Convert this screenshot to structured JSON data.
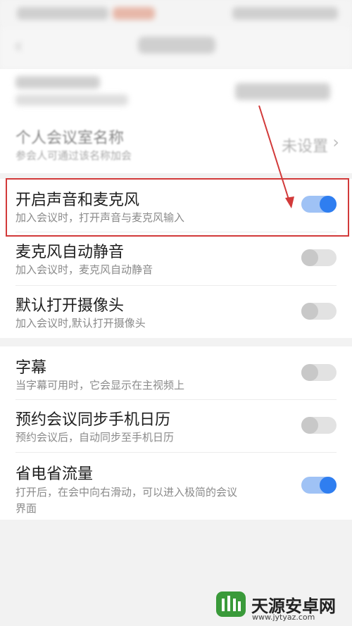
{
  "app": {
    "title": "会议设置"
  },
  "room_name": {
    "title": "个人会议室名称",
    "subtitle": "参会人可通过该名称加会",
    "value": "未设置"
  },
  "settings_group1": [
    {
      "title": "开启声音和麦克风",
      "subtitle": "加入会议时，打开声音与麦克风输入",
      "on": true
    },
    {
      "title": "麦克风自动静音",
      "subtitle": "加入会议时，麦克风自动静音",
      "on": false
    },
    {
      "title": "默认打开摄像头",
      "subtitle": "加入会议时,默认打开摄像头",
      "on": false
    }
  ],
  "settings_group2": [
    {
      "title": "字幕",
      "subtitle": "当字幕可用时，它会显示在主视频上",
      "on": false
    },
    {
      "title": "预约会议同步手机日历",
      "subtitle": "预约会议后，自动同步至手机日历",
      "on": false
    },
    {
      "title": "省电省流量",
      "subtitle_line1": "打开后，在会中向右滑动，可以进入极简的会议",
      "subtitle_line2": "界面",
      "on": true
    }
  ],
  "watermark": {
    "name": "天源安卓网",
    "url": "www.jytyaz.com"
  },
  "colors": {
    "accent": "#2f7ef0",
    "highlight": "#d23a3a"
  }
}
